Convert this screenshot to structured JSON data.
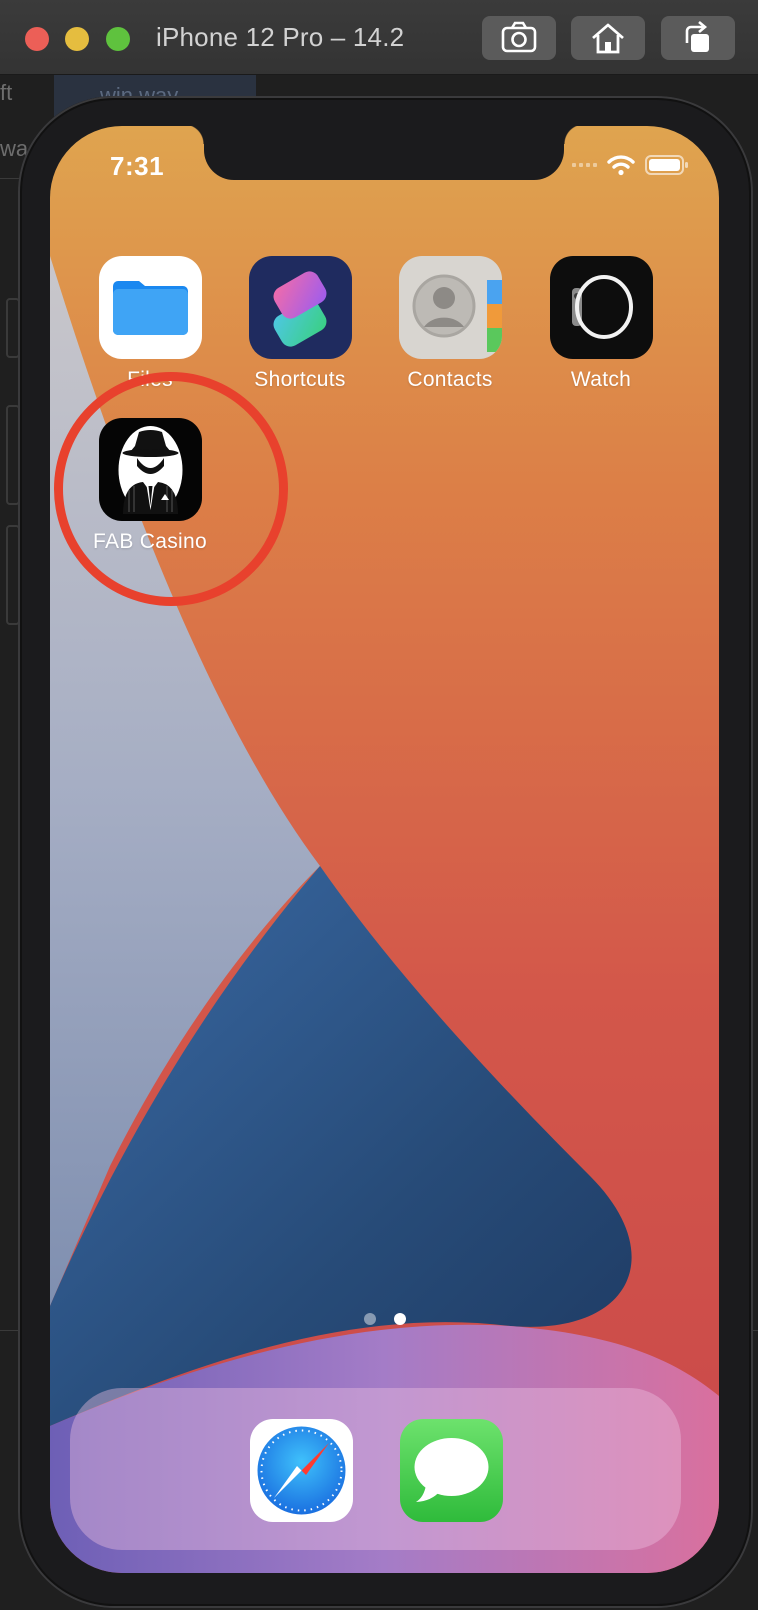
{
  "window": {
    "title": "iPhone 12 Pro – 14.2",
    "buttons": [
      {
        "name": "screenshot",
        "icon": "camera-icon"
      },
      {
        "name": "home",
        "icon": "home-icon"
      },
      {
        "name": "rotate",
        "icon": "rotate-icon"
      }
    ]
  },
  "ide_background": {
    "tab_label": "win way",
    "left_fragment_1": "ft",
    "left_fragment_2": "wa"
  },
  "status_bar": {
    "time": "7:31",
    "icons": [
      "signal-dots-icon",
      "wifi-icon",
      "battery-icon"
    ]
  },
  "apps": [
    {
      "label": "Files",
      "icon": "files-folder-icon"
    },
    {
      "label": "Shortcuts",
      "icon": "shortcuts-icon"
    },
    {
      "label": "Contacts",
      "icon": "contacts-icon"
    },
    {
      "label": "Watch",
      "icon": "watch-icon"
    },
    {
      "label": "FAB Casino",
      "icon": "fab-casino-gangster-icon"
    }
  ],
  "annotation": {
    "type": "circle",
    "color": "#e8412d",
    "target": "FAB Casino"
  },
  "page_dots": {
    "count": 2,
    "active_index": 1
  },
  "dock": [
    {
      "name": "Safari",
      "icon": "safari-compass-icon"
    },
    {
      "name": "Messages",
      "icon": "messages-bubble-icon"
    }
  ],
  "colors": {
    "wallpaper_top": "#dfa44f",
    "wallpaper_red": "#c9474a",
    "wallpaper_blue": "#2e4d78",
    "annotation_red": "#e8412d"
  }
}
